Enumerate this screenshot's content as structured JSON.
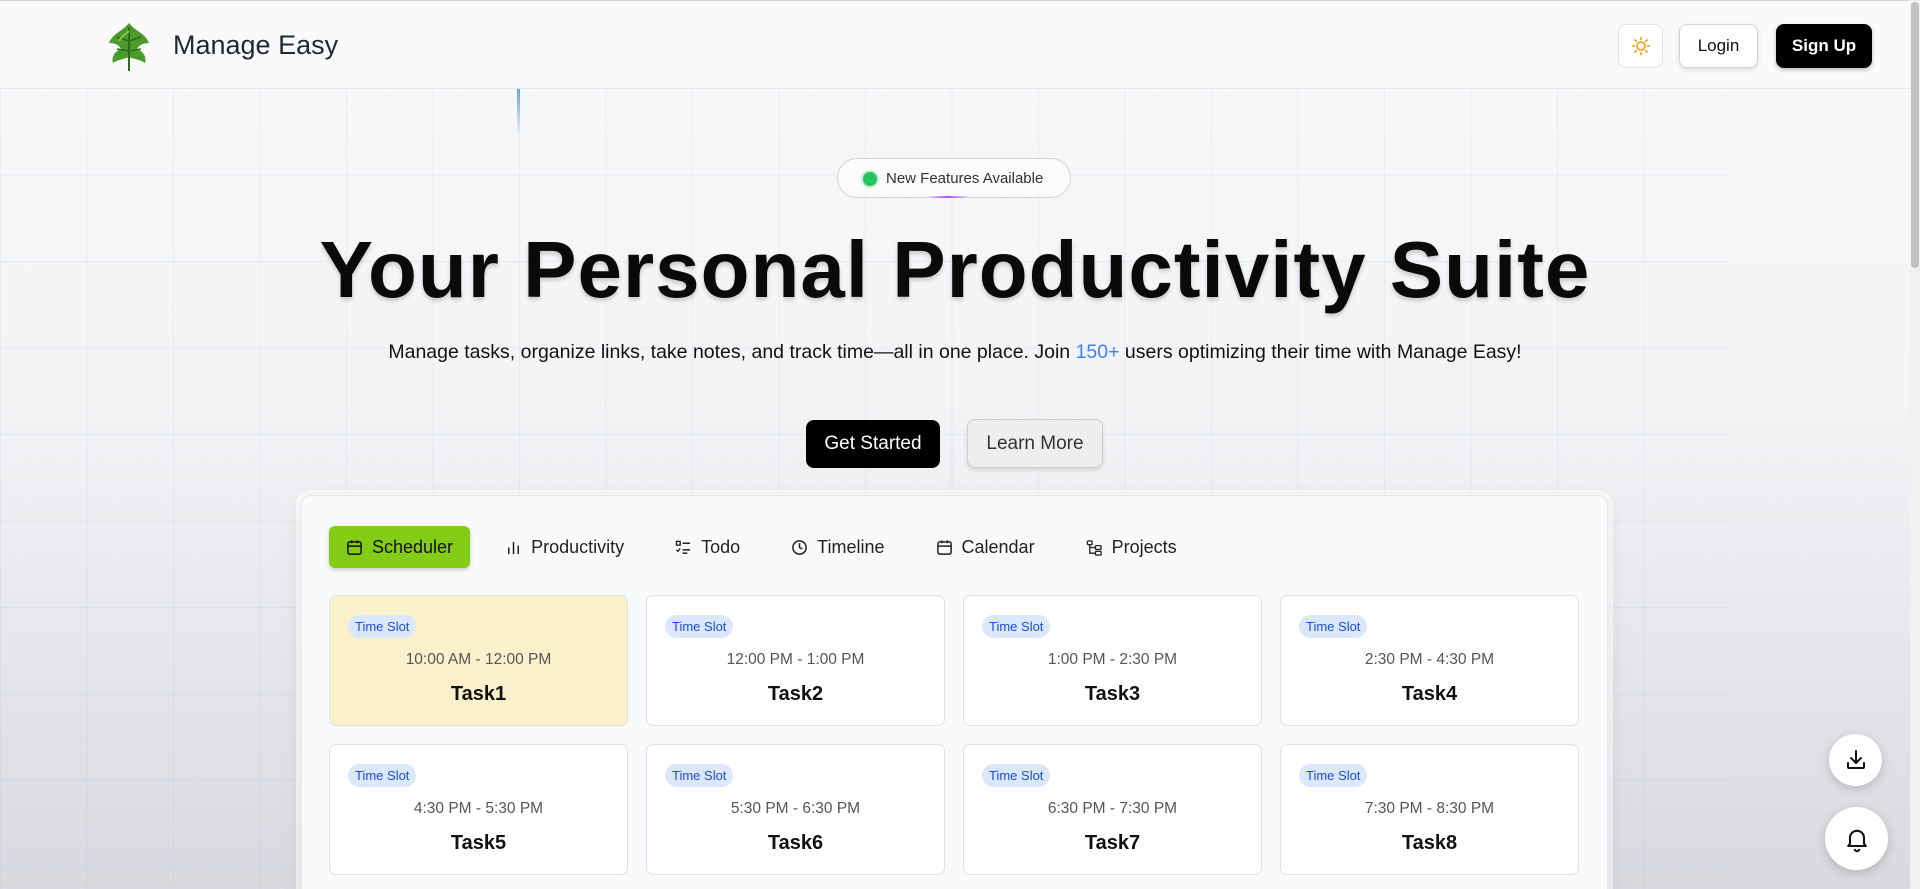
{
  "header": {
    "app_name": "Manage Easy",
    "logo_icon": "leaf-logo-icon",
    "theme_icon": "sun-icon",
    "login_label": "Login",
    "signup_label": "Sign Up"
  },
  "hero": {
    "badge_text": "New Features Available",
    "title": "Your Personal Productivity Suite",
    "subtitle_before": "Manage tasks, organize links, take notes, and track time—all in one place. Join ",
    "subtitle_highlight": "150+",
    "subtitle_after": " users optimizing their time with Manage Easy!",
    "primary_cta": "Get Started",
    "secondary_cta": "Learn More"
  },
  "tabs": [
    {
      "label": "Scheduler",
      "icon": "calendar-icon",
      "active": true
    },
    {
      "label": "Productivity",
      "icon": "bar-chart-icon",
      "active": false
    },
    {
      "label": "Todo",
      "icon": "list-check-icon",
      "active": false
    },
    {
      "label": "Timeline",
      "icon": "clock-icon",
      "active": false
    },
    {
      "label": "Calendar",
      "icon": "calendar-icon",
      "active": false
    },
    {
      "label": "Projects",
      "icon": "folder-tree-icon",
      "active": false
    }
  ],
  "scheduler": {
    "badge_label": "Time Slot",
    "cards": [
      {
        "time": "10:00 AM - 12:00 PM",
        "name": "Task1",
        "highlighted": true
      },
      {
        "time": "12:00 PM - 1:00 PM",
        "name": "Task2",
        "highlighted": false
      },
      {
        "time": "1:00 PM - 2:30 PM",
        "name": "Task3",
        "highlighted": false
      },
      {
        "time": "2:30 PM - 4:30 PM",
        "name": "Task4",
        "highlighted": false
      },
      {
        "time": "4:30 PM - 5:30 PM",
        "name": "Task5",
        "highlighted": false
      },
      {
        "time": "5:30 PM - 6:30 PM",
        "name": "Task6",
        "highlighted": false
      },
      {
        "time": "6:30 PM - 7:30 PM",
        "name": "Task7",
        "highlighted": false
      },
      {
        "time": "7:30 PM - 8:30 PM",
        "name": "Task8",
        "highlighted": false
      }
    ]
  },
  "floating": {
    "download_icon": "download-icon",
    "bell_icon": "bell-icon"
  },
  "colors": {
    "accent": "#84cc16",
    "highlight_text": "#3b82f6",
    "status_dot": "#22c55e",
    "card_highlight": "#faf1cc",
    "badge_bg": "#dbe7fb"
  }
}
